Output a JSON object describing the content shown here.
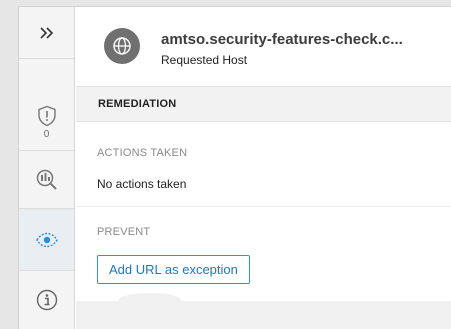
{
  "header": {
    "host_name": "amtso.security-features-check.c...",
    "host_type": "Requested Host"
  },
  "rail": {
    "expand_icon": "double-chevron-right-icon",
    "threat_count": "0",
    "items": [
      {
        "icon": "shield-exclamation-icon"
      },
      {
        "icon": "magnifier-analysis-icon"
      },
      {
        "icon": "eye-icon"
      },
      {
        "icon": "info-icon"
      }
    ]
  },
  "section": {
    "title": "REMEDIATION"
  },
  "actions_taken": {
    "label": "ACTIONS TAKEN",
    "value": "No actions taken"
  },
  "prevent": {
    "label": "PREVENT",
    "button_label": "Add URL as exception"
  },
  "colors": {
    "accent": "#1d78c1",
    "globe": "#707070"
  }
}
